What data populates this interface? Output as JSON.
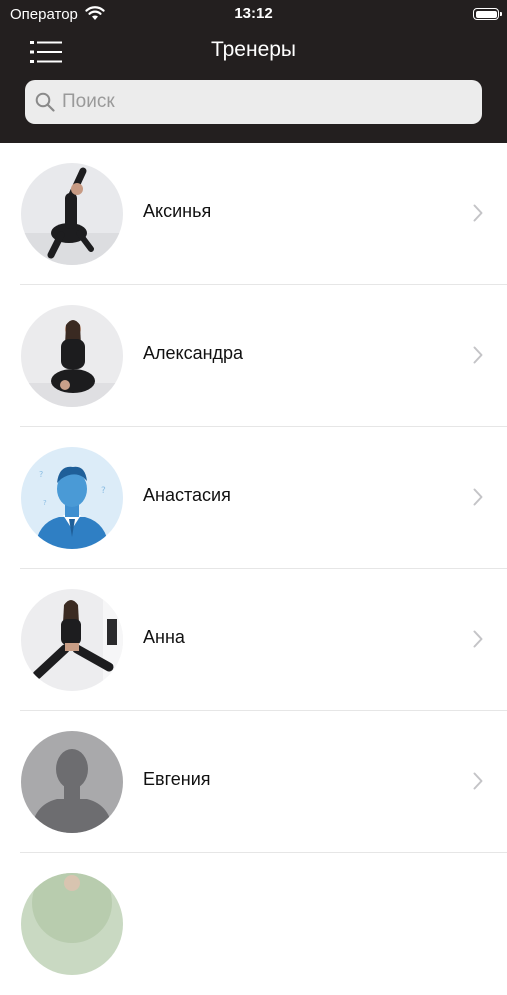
{
  "status_bar": {
    "carrier": "Оператор",
    "time": "13:12"
  },
  "header": {
    "title": "Тренеры",
    "menu_icon": "menu-icon"
  },
  "search": {
    "placeholder": "Поиск",
    "value": ""
  },
  "trainers": [
    {
      "name": "Аксинья",
      "avatar": "photo-avatar"
    },
    {
      "name": "Александра",
      "avatar": "photo-avatar"
    },
    {
      "name": "Анастасия",
      "avatar": "placeholder-avatar-blue"
    },
    {
      "name": "Анна",
      "avatar": "photo-avatar"
    },
    {
      "name": "Евгения",
      "avatar": "placeholder-avatar-gray"
    },
    {
      "name": "",
      "avatar": "photo-avatar"
    }
  ],
  "colors": {
    "header_bg": "#231f1f",
    "search_bg": "#ececec",
    "separator": "#e6e6e6"
  }
}
